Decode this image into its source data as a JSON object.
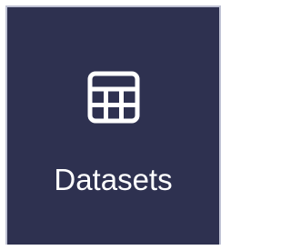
{
  "tile": {
    "label": "Datasets",
    "icon": "table-icon"
  },
  "colors": {
    "background": "#2e3150",
    "border": "#bfc2d4",
    "text": "#ffffff"
  }
}
